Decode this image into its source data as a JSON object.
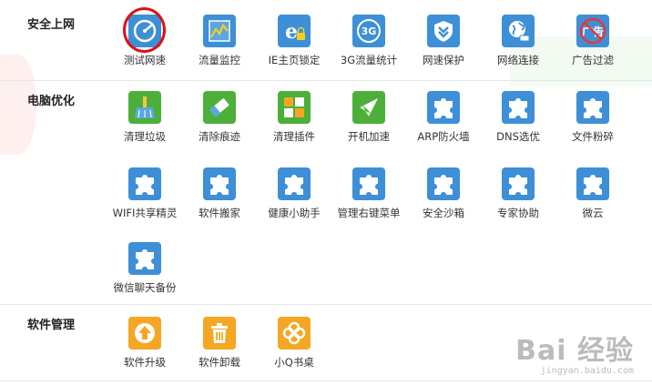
{
  "sections": {
    "security": {
      "title": "安全上网",
      "tools": [
        {
          "label": "测试网速",
          "icon": "speedometer-icon"
        },
        {
          "label": "流量监控",
          "icon": "chart-icon"
        },
        {
          "label": "IE主页锁定",
          "icon": "ie-lock-icon"
        },
        {
          "label": "3G流量统计",
          "icon": "3g-icon"
        },
        {
          "label": "网速保护",
          "icon": "shield-icon"
        },
        {
          "label": "网络连接",
          "icon": "globe-icon"
        },
        {
          "label": "广告过滤",
          "icon": "ad-block-icon"
        }
      ],
      "icon_texts": {
        "three_g": "3G",
        "ad": "广告"
      }
    },
    "optimize": {
      "title": "电脑优化",
      "tools": [
        {
          "label": "清理垃圾",
          "icon": "broom-icon"
        },
        {
          "label": "清除痕迹",
          "icon": "eraser-icon"
        },
        {
          "label": "清理插件",
          "icon": "plugin-icon"
        },
        {
          "label": "开机加速",
          "icon": "rocket-icon"
        },
        {
          "label": "ARP防火墙",
          "icon": "puzzle-icon"
        },
        {
          "label": "DNS选优",
          "icon": "puzzle-icon"
        },
        {
          "label": "文件粉碎",
          "icon": "puzzle-icon"
        },
        {
          "label": "WIFI共享精灵",
          "icon": "puzzle-icon"
        },
        {
          "label": "软件搬家",
          "icon": "puzzle-icon"
        },
        {
          "label": "健康小助手",
          "icon": "puzzle-icon"
        },
        {
          "label": "管理右键菜单",
          "icon": "puzzle-icon"
        },
        {
          "label": "安全沙箱",
          "icon": "puzzle-icon"
        },
        {
          "label": "专家协助",
          "icon": "puzzle-icon"
        },
        {
          "label": "微云",
          "icon": "puzzle-icon"
        },
        {
          "label": "微信聊天备份",
          "icon": "puzzle-icon"
        }
      ]
    },
    "software": {
      "title": "软件管理",
      "tools": [
        {
          "label": "软件升级",
          "icon": "upgrade-icon"
        },
        {
          "label": "软件卸载",
          "icon": "trash-icon"
        },
        {
          "label": "小Q书桌",
          "icon": "clover-icon"
        }
      ]
    }
  },
  "watermark": {
    "main": "Bai 经验",
    "sub": "jingyan.baidu.com"
  },
  "colors": {
    "blue_tile": "#3d8fd8",
    "green_tile": "#4caf3a",
    "orange_tile": "#f5a623",
    "highlight_ring": "#e01010"
  }
}
